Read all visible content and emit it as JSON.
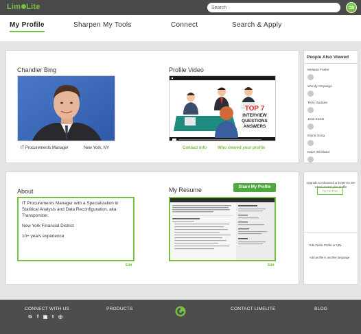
{
  "topbar": {
    "logo_text_before": "Lim",
    "logo_text_after": "Lite",
    "search_placeholder": "Search",
    "avatar_initials": "CB",
    "accent": "#76c043"
  },
  "nav": {
    "items": [
      {
        "label": "My Profile",
        "active": true
      },
      {
        "label": "Sharpen My Tools"
      },
      {
        "label": "Connect"
      },
      {
        "label": "Search & Apply"
      }
    ]
  },
  "profile": {
    "name": "Chandler Bing",
    "title": "IT Procurements Manager",
    "location": "New York, NY",
    "video_heading": "Profile Video",
    "video_overlay": [
      "TOP 7",
      "INTERVIEW",
      "QUESTIONS",
      "ANSWERS"
    ],
    "contact_link": "Contact Info",
    "viewed_link": "Who viewed your profile"
  },
  "about": {
    "heading": "About",
    "paragraphs": [
      "IT Procurements Manager with a Specialization in Statitical Analysis and Data Reconfiguration, aka Transponster.",
      "New York Financial District",
      "10+ years experience"
    ],
    "edit": "Edit"
  },
  "resume": {
    "heading": "My Resume",
    "share_button": "Share My Profile",
    "edit": "Edit"
  },
  "people_also_viewed": {
    "heading": "People Also Viewed",
    "people": [
      "Melanie Foster",
      "Wendy Onyango",
      "Terry Gadaire",
      "Jenn Kamb",
      "Diana Song",
      "Dave Wickland"
    ]
  },
  "upgrade": {
    "text": "Upgrade to Advanced or Expert to see who's viewed your profile",
    "button": "Try For Free"
  },
  "side_links": [
    "Edit Public Profile or URL",
    "Add profile in another language"
  ],
  "footer": {
    "connect": "CONNECT WITH US",
    "products": "PRODUCTS",
    "contact": "CONTACT LIMELITE",
    "blog": "BLOG",
    "social_icons": [
      "google-icon",
      "facebook-icon",
      "instagram-icon",
      "twitter-icon",
      "camera-icon"
    ]
  }
}
